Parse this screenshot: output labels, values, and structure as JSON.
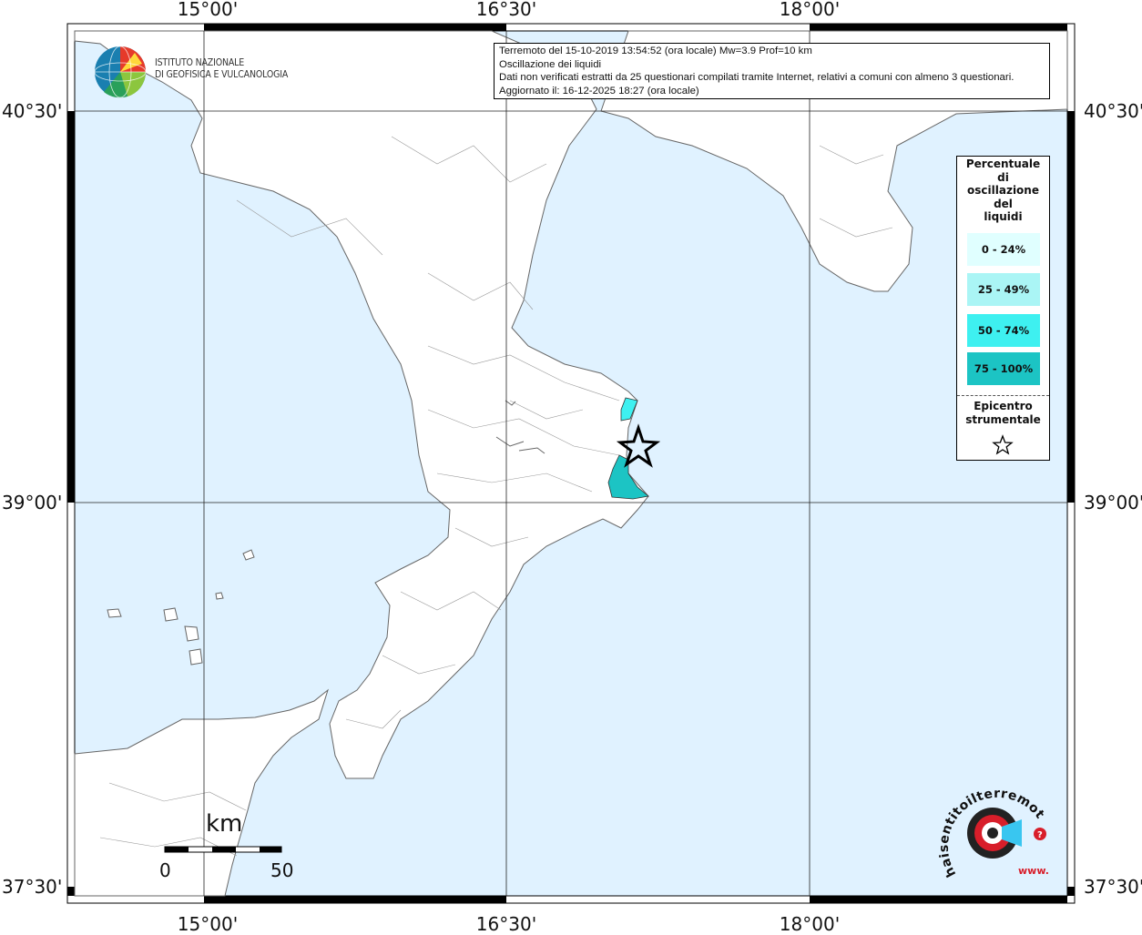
{
  "map": {
    "lon_ticks": [
      "15°00'",
      "16°30'",
      "18°00'"
    ],
    "lat_ticks": [
      "40°30'",
      "39°00'",
      "37°30'"
    ]
  },
  "info": {
    "line1": "Terremoto del 15-10-2019 13:54:52 (ora locale) Mw=3.9 Prof=10 km",
    "line2": "Oscillazione dei liquidi",
    "line3": "Dati non verificati estratti da 25 questionari compilati tramite Internet, relativi a comuni con almeno 3 questionari.",
    "line4": "Aggiornato il: 16-12-2025 18:27 (ora locale)"
  },
  "logo": {
    "line1": "ISTITUTO NAZIONALE",
    "line2": "DI GEOFISICA E VULCANOLOGIA"
  },
  "legend": {
    "title_lines": [
      "Percentuale",
      "di",
      "oscillazione",
      "del",
      "liquidi"
    ],
    "items": [
      {
        "label": "0 - 24%",
        "color": "#e0ffff"
      },
      {
        "label": "25 - 49%",
        "color": "#aaf5f5"
      },
      {
        "label": "50 - 74%",
        "color": "#3ef0f0"
      },
      {
        "label": "75 - 100%",
        "color": "#1cc4c4"
      }
    ],
    "epicenter_lines": [
      "Epicentro",
      "strumentale"
    ],
    "epicenter_icon": "star-icon"
  },
  "scale": {
    "unit": "km",
    "label_start": "0",
    "label_end": "50"
  },
  "colors": {
    "sea": "#e0f2ff",
    "land": "#ffffff",
    "border": "#808080",
    "area_25_49": "#3ef0f0",
    "area_75_100": "#1cc4c4"
  },
  "brand": {
    "site_logo_text": "haisentitoilterremoto.it",
    "site_logo_www": "www."
  }
}
